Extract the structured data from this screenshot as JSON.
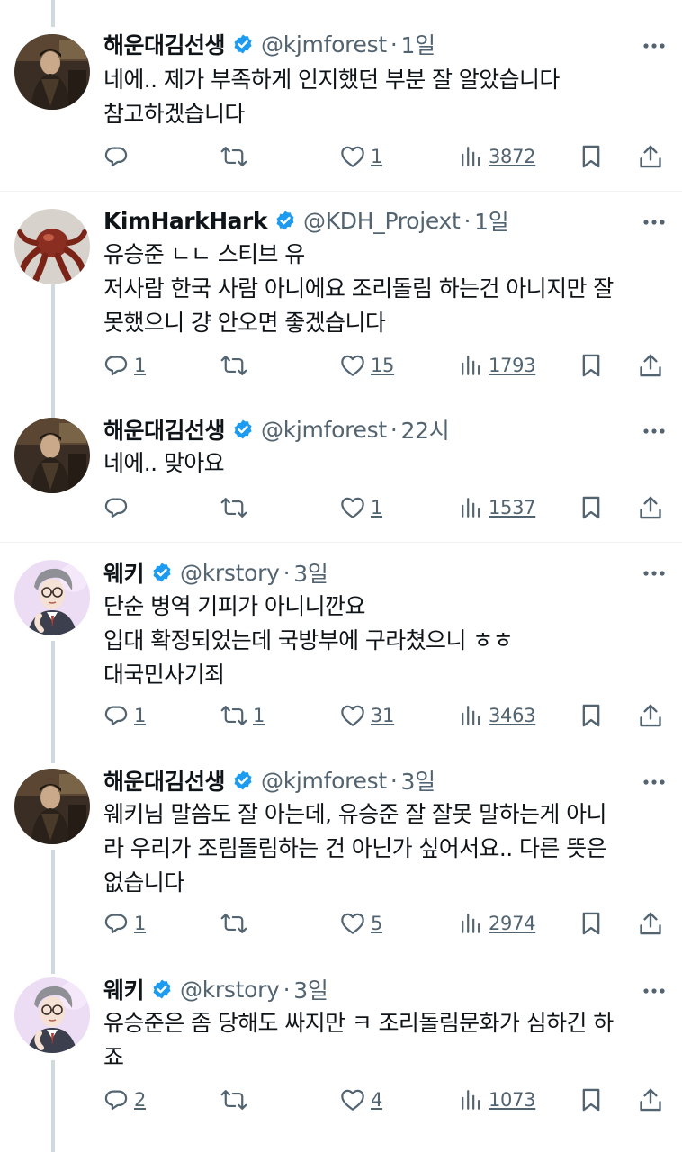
{
  "tweets": [
    {
      "name": "해운대김선생",
      "handle": "@kjmforest",
      "time": "1일",
      "lines": [
        "네에.. 제가 부족하게 인지했던 부분 잘 알았습니다",
        "참고하겠습니다"
      ],
      "replies": "",
      "retweets": "",
      "likes": "1",
      "views": "3872",
      "avatar": "kjm"
    },
    {
      "name": "KimHarkHark",
      "handle": "@KDH_Projext",
      "time": "1일",
      "lines": [
        "유승준 ㄴㄴ 스티브 유",
        "저사람 한국 사람 아니에요 조리돌림 하는건 아니지만 잘",
        "못했으니 걍 안오면 좋겠습니다"
      ],
      "replies": "1",
      "retweets": "",
      "likes": "15",
      "views": "1793",
      "avatar": "khh"
    },
    {
      "name": "해운대김선생",
      "handle": "@kjmforest",
      "time": "22시",
      "lines": [
        "네에.. 맞아요"
      ],
      "replies": "",
      "retweets": "",
      "likes": "1",
      "views": "1537",
      "avatar": "kjm"
    },
    {
      "name": "웨키",
      "handle": "@krstory",
      "time": "3일",
      "lines": [
        "단순 병역 기피가 아니니깐요",
        "입대 확정되었는데 국방부에 구라쳤으니 ㅎㅎ",
        "대국민사기죄"
      ],
      "replies": "1",
      "retweets": "1",
      "likes": "31",
      "views": "3463",
      "avatar": "wk"
    },
    {
      "name": "해운대김선생",
      "handle": "@kjmforest",
      "time": "3일",
      "lines": [
        "웨키님 말씀도 잘 아는데, 유승준 잘 잘못 말하는게 아니",
        "라 우리가 조림돌림하는 건 아닌가 싶어서요.. 다른 뜻은",
        "없습니다"
      ],
      "replies": "1",
      "retweets": "",
      "likes": "5",
      "views": "2974",
      "avatar": "kjm"
    },
    {
      "name": "웨키",
      "handle": "@krstory",
      "time": "3일",
      "lines": [
        "유승준은 좀 당해도 싸지만 ㅋ 조리돌림문화가 심하긴 하",
        "죠"
      ],
      "replies": "2",
      "retweets": "",
      "likes": "4",
      "views": "1073",
      "avatar": "wk"
    }
  ],
  "colors": {
    "text": "#0f1419",
    "secondary": "#536471",
    "verified": "#1d9bf0",
    "thread_line": "#cfd9de",
    "divider": "#eff3f4"
  }
}
